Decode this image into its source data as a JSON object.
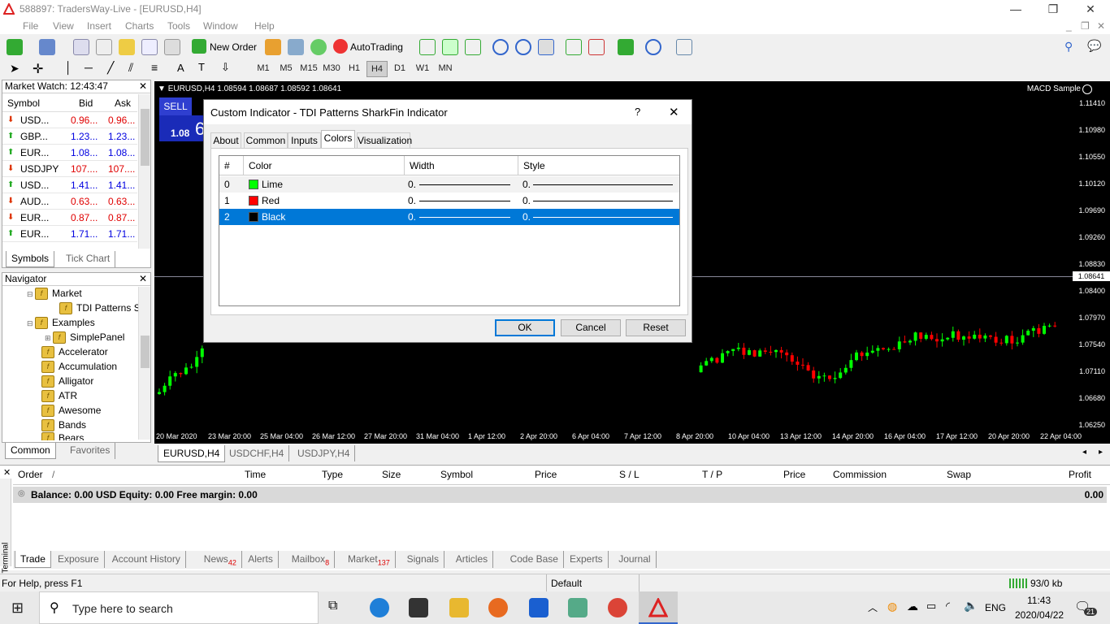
{
  "window": {
    "title": "588897: TradersWay-Live - [EURUSD,H4]"
  },
  "menu": [
    "File",
    "View",
    "Insert",
    "Charts",
    "Tools",
    "Window",
    "Help"
  ],
  "toolbar": {
    "new_order": "New Order",
    "auto_trading": "AutoTrading"
  },
  "timeframes": [
    "M1",
    "M5",
    "M15",
    "M30",
    "H1",
    "H4",
    "D1",
    "W1",
    "MN"
  ],
  "selected_timeframe": "H4",
  "market_watch": {
    "title": "Market Watch: 12:43:47",
    "columns": [
      "Symbol",
      "Bid",
      "Ask"
    ],
    "rows": [
      {
        "symbol": "USD...",
        "bid": "0.96...",
        "ask": "0.96...",
        "dir": "down",
        "color": "#e00000"
      },
      {
        "symbol": "GBP...",
        "bid": "1.23...",
        "ask": "1.23...",
        "dir": "up",
        "color": "#0000e0"
      },
      {
        "symbol": "EUR...",
        "bid": "1.08...",
        "ask": "1.08...",
        "dir": "up",
        "color": "#0000e0"
      },
      {
        "symbol": "USDJPY",
        "bid": "107....",
        "ask": "107....",
        "dir": "down",
        "color": "#e00000"
      },
      {
        "symbol": "USD...",
        "bid": "1.41...",
        "ask": "1.41...",
        "dir": "up",
        "color": "#0000e0"
      },
      {
        "symbol": "AUD...",
        "bid": "0.63...",
        "ask": "0.63...",
        "dir": "down",
        "color": "#e00000"
      },
      {
        "symbol": "EUR...",
        "bid": "0.87...",
        "ask": "0.87...",
        "dir": "down",
        "color": "#e00000"
      },
      {
        "symbol": "EUR...",
        "bid": "1.71...",
        "ask": "1.71...",
        "dir": "up",
        "color": "#0000e0"
      }
    ],
    "tabs": [
      "Symbols",
      "Tick Chart"
    ]
  },
  "navigator": {
    "title": "Navigator",
    "items": [
      "Market",
      "TDI Patterns S",
      "Examples",
      "SimplePanel",
      "Accelerator",
      "Accumulation",
      "Alligator",
      "ATR",
      "Awesome",
      "Bands",
      "Bears"
    ],
    "tabs": [
      "Common",
      "Favorites"
    ]
  },
  "chart": {
    "header": "EURUSD,H4  1.08594 1.08687 1.08592 1.08641",
    "indicator": "MACD Sample",
    "sell_label": "SELL",
    "sell_price": "1.08",
    "sell_big": "6",
    "current_price": "1.08641",
    "price_labels": [
      "1.11410",
      "1.10980",
      "1.10550",
      "1.10120",
      "1.09690",
      "1.09260",
      "1.08830",
      "1.08400",
      "1.07970",
      "1.07540",
      "1.07110",
      "1.06680",
      "1.06250"
    ],
    "time_labels": [
      "20 Mar 2020",
      "23 Mar 20:00",
      "25 Mar 04:00",
      "26 Mar 12:00",
      "27 Mar 20:00",
      "31 Mar 04:00",
      "1 Apr 12:00",
      "2 Apr 20:00",
      "6 Apr 04:00",
      "7 Apr 12:00",
      "8 Apr 20:00",
      "10 Apr 04:00",
      "13 Apr 12:00",
      "14 Apr 20:00",
      "16 Apr 04:00",
      "17 Apr 12:00",
      "20 Apr 20:00",
      "22 Apr 04:00"
    ],
    "tabs": [
      "EURUSD,H4",
      "USDCHF,H4",
      "USDJPY,H4"
    ]
  },
  "dialog": {
    "title": "Custom Indicator - TDI Patterns SharkFin Indicator",
    "help": "?",
    "close": "✕",
    "tabs": [
      "About",
      "Common",
      "Inputs",
      "Colors",
      "Visualization"
    ],
    "active_tab": "Colors",
    "columns": [
      "#",
      "Color",
      "Width",
      "Style"
    ],
    "rows": [
      {
        "index": "0",
        "color_name": "Lime",
        "swatch": "#00ff00",
        "width": "0.",
        "style": "0."
      },
      {
        "index": "1",
        "color_name": "Red",
        "swatch": "#ff0000",
        "width": "0.",
        "style": "0."
      },
      {
        "index": "2",
        "color_name": "Black",
        "swatch": "#000000",
        "width": "0.",
        "style": "0."
      }
    ],
    "selected_row": 2,
    "buttons": {
      "ok": "OK",
      "cancel": "Cancel",
      "reset": "Reset"
    }
  },
  "terminal": {
    "columns": [
      "Order",
      "/",
      "Time",
      "Type",
      "Size",
      "Symbol",
      "Price",
      "S / L",
      "T / P",
      "Price",
      "Commission",
      "Swap",
      "Profit"
    ],
    "balance_line": "Balance: 0.00 USD  Equity: 0.00  Free margin: 0.00",
    "balance_profit": "0.00",
    "side_label": "Terminal",
    "tabs": [
      {
        "label": "Trade",
        "badge": ""
      },
      {
        "label": "Exposure",
        "badge": ""
      },
      {
        "label": "Account History",
        "badge": ""
      },
      {
        "label": "News",
        "badge": "42"
      },
      {
        "label": "Alerts",
        "badge": ""
      },
      {
        "label": "Mailbox",
        "badge": "8"
      },
      {
        "label": "Market",
        "badge": "137"
      },
      {
        "label": "Signals",
        "badge": ""
      },
      {
        "label": "Articles",
        "badge": ""
      },
      {
        "label": "Code Base",
        "badge": ""
      },
      {
        "label": "Experts",
        "badge": ""
      },
      {
        "label": "Journal",
        "badge": ""
      }
    ]
  },
  "status": {
    "help": "For Help, press F1",
    "profile": "Default",
    "traffic": "93/0 kb"
  },
  "taskbar": {
    "search_placeholder": "Type here to search",
    "time": "11:43",
    "date": "2020/04/22",
    "lang": "ENG",
    "notifications": "21"
  }
}
